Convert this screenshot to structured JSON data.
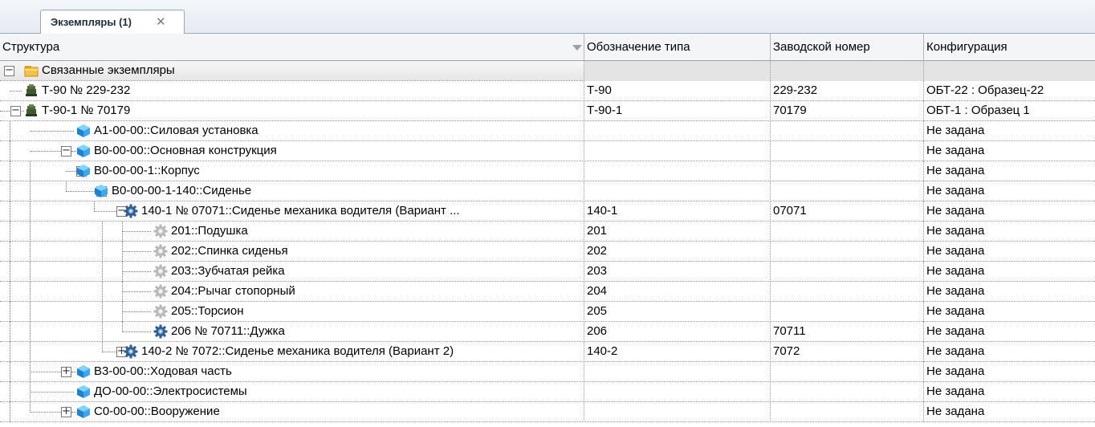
{
  "tab": {
    "label": "Экземпляры (1)",
    "close_icon": "close-icon"
  },
  "columns": [
    "Структура",
    "Обозначение типа",
    "Заводской номер",
    "Конфигурация"
  ],
  "colors": {
    "selected_row": "#e4e4e4",
    "header_bg": "#f4f5f7",
    "tab_text": "#1c2c44"
  },
  "rows": [
    {
      "label": "Связанные экземпляры",
      "type": "",
      "serial": "",
      "config": "",
      "icon": "folder-icon",
      "expander": "collapse"
    },
    {
      "label": "Т-90 № 229-232",
      "type": "Т-90",
      "serial": "229-232",
      "config": "ОБТ-22 : Образец-22",
      "icon": "tank-icon",
      "expander": ""
    },
    {
      "label": "Т-90-1  № 70179",
      "type": "Т-90-1",
      "serial": "70179",
      "config": "ОБТ-1 : Образец 1",
      "icon": "tank-icon",
      "expander": "collapse"
    },
    {
      "label": "А1-00-00::Силовая установка",
      "type": "",
      "serial": "",
      "config": "Не задана",
      "icon": "cube-icon",
      "expander": ""
    },
    {
      "label": "В0-00-00::Основная конструкция",
      "type": "",
      "serial": "",
      "config": "Не задана",
      "icon": "cube-icon",
      "expander": "collapse"
    },
    {
      "label": "В0-00-00-1::Корпус",
      "type": "",
      "serial": "",
      "config": "Не задана",
      "icon": "cube-icon",
      "expander": "collapse"
    },
    {
      "label": "В0-00-00-1-140::Сиденье",
      "type": "",
      "serial": "",
      "config": "Не задана",
      "icon": "cube-icon",
      "expander": "collapse"
    },
    {
      "label": "140-1 № 07071::Сиденье механика водителя (Вариант ...",
      "type": "140-1",
      "serial": "07071",
      "config": "Не задана",
      "icon": "gear-icon",
      "expander": "collapse"
    },
    {
      "label": "201::Подушка",
      "type": "201",
      "serial": "",
      "config": "Не задана",
      "icon": "gear-gray-icon",
      "expander": ""
    },
    {
      "label": "202::Спинка сиденья",
      "type": "202",
      "serial": "",
      "config": "Не задана",
      "icon": "gear-gray-icon",
      "expander": ""
    },
    {
      "label": "203::Зубчатая рейка",
      "type": "203",
      "serial": "",
      "config": "Не задана",
      "icon": "gear-gray-icon",
      "expander": ""
    },
    {
      "label": "204::Рычаг стопорный",
      "type": "204",
      "serial": "",
      "config": "Не задана",
      "icon": "gear-gray-icon",
      "expander": ""
    },
    {
      "label": "205::Торсион",
      "type": "205",
      "serial": "",
      "config": "Не задана",
      "icon": "gear-gray-icon",
      "expander": ""
    },
    {
      "label": "206 № 70711::Дужка",
      "type": "206",
      "serial": "70711",
      "config": "Не задана",
      "icon": "gear-icon",
      "expander": ""
    },
    {
      "label": "140-2 № 7072::Сиденье механика водителя (Вариант 2)",
      "type": "140-2",
      "serial": "7072",
      "config": "Не задана",
      "icon": "gear-icon",
      "expander": "expand"
    },
    {
      "label": "В3-00-00::Ходовая часть",
      "type": "",
      "serial": "",
      "config": "Не задана",
      "icon": "cube-icon",
      "expander": "expand"
    },
    {
      "label": "ДО-00-00::Электросистемы",
      "type": "",
      "serial": "",
      "config": "Не задана",
      "icon": "cube-icon",
      "expander": ""
    },
    {
      "label": "С0-00-00::Вооружение",
      "type": "",
      "serial": "",
      "config": "Не задана",
      "icon": "cube-icon",
      "expander": "expand"
    }
  ]
}
